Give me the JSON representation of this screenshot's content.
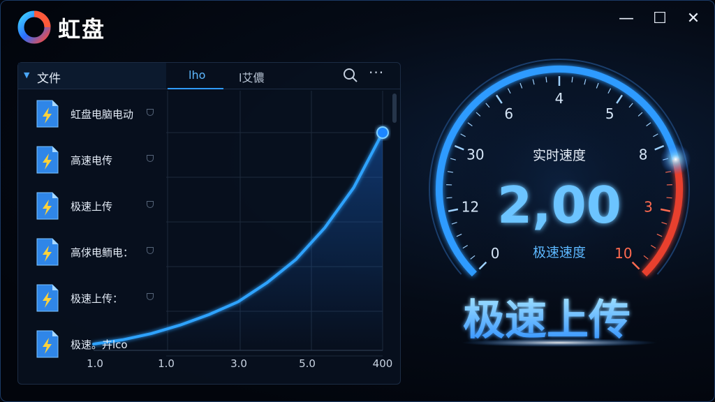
{
  "app": {
    "title": "虹盘"
  },
  "window_controls": {
    "minimize": "—",
    "maximize": "☐",
    "close": "✕"
  },
  "colors": {
    "accent": "#2f9bff",
    "danger": "#e8412e",
    "background": "#02050c"
  },
  "panel": {
    "section_label": "文件",
    "tabs": [
      {
        "label": "lho"
      },
      {
        "label": "l艾儂"
      }
    ],
    "search_icon": "search-icon",
    "more_label": "···",
    "files": [
      {
        "name": "虹盘电脑电动",
        "icon": "bolt-file-icon"
      },
      {
        "name": "高速电传",
        "icon": "bolt-file-icon"
      },
      {
        "name": "极速上传",
        "icon": "bolt-file-icon"
      },
      {
        "name": "高俅电鲕电：",
        "icon": "bolt-file-icon"
      },
      {
        "name": "极速上传：",
        "icon": "bolt-file-icon"
      },
      {
        "name": "极速。卉lco",
        "icon": "bolt-file-icon"
      }
    ]
  },
  "chart_data": {
    "type": "line",
    "tick_labels": [
      "1.0",
      "1.0",
      "3.0",
      "5.0",
      "400"
    ],
    "x": [
      0,
      0.1,
      0.2,
      0.3,
      0.4,
      0.5,
      0.6,
      0.7,
      0.8,
      0.9,
      1.0
    ],
    "series": [
      {
        "values": [
          0,
          0.02,
          0.05,
          0.09,
          0.14,
          0.2,
          0.29,
          0.4,
          0.55,
          0.74,
          1.0
        ]
      }
    ],
    "grid": true,
    "end_marker": true
  },
  "speedometer": {
    "title": "实时速度",
    "value": "2,00",
    "subtitle": "极速速度",
    "tick_labels": [
      "0",
      "12",
      "30",
      "6",
      "4",
      "5",
      "8",
      "3",
      "10"
    ],
    "level": 0.78
  },
  "banner": {
    "text": "极速上传"
  }
}
